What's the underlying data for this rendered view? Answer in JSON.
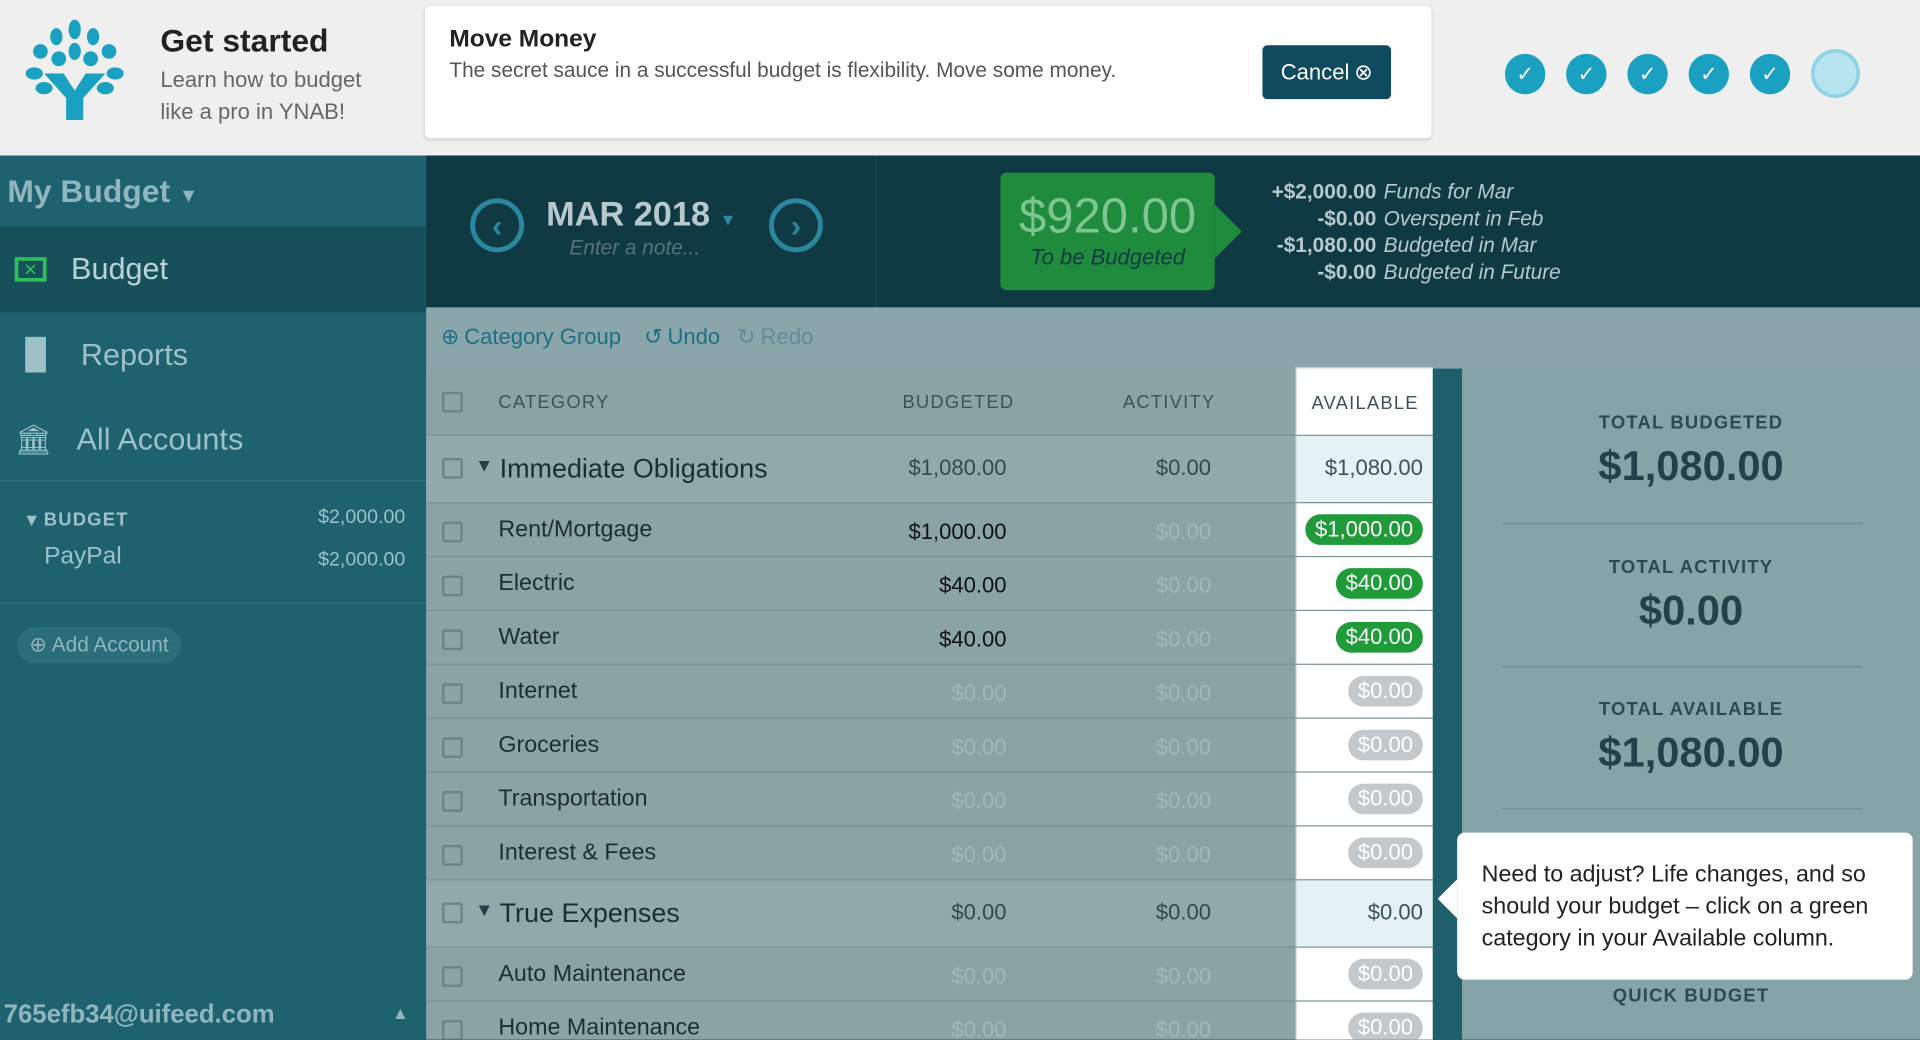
{
  "onboarding": {
    "title": "Get started",
    "subtitle": "Learn how to budget like a pro in YNAB!",
    "step_title": "Move Money",
    "step_text": "The secret sauce in a successful budget is flexibility. Move some money.",
    "cancel_label": "Cancel",
    "steps_completed": 5,
    "steps_total": 6
  },
  "sidebar": {
    "budget_name": "My Budget",
    "nav": [
      {
        "label": "Budget",
        "icon": "envelope-icon"
      },
      {
        "label": "Reports",
        "icon": "bar-chart-icon"
      },
      {
        "label": "All Accounts",
        "icon": "bank-icon"
      }
    ],
    "account_group": "BUDGET",
    "account_group_total": "$2,000.00",
    "accounts": [
      {
        "name": "PayPal",
        "balance": "$2,000.00"
      }
    ],
    "add_account": "Add Account",
    "email": "765efb34@uifeed.com"
  },
  "header": {
    "month": "MAR 2018",
    "note_placeholder": "Enter a note...",
    "to_be_budgeted": "$920.00",
    "to_be_budgeted_label": "To be Budgeted",
    "breakdown": [
      {
        "amount": "+$2,000.00",
        "label": "Funds for Mar"
      },
      {
        "amount": "-$0.00",
        "label": "Overspent in Feb"
      },
      {
        "amount": "-$1,080.00",
        "label": "Budgeted in Mar"
      },
      {
        "amount": "-$0.00",
        "label": "Budgeted in Future"
      }
    ]
  },
  "toolbar": {
    "category_group": "Category Group",
    "undo": "Undo",
    "redo": "Redo"
  },
  "table": {
    "columns": [
      "CATEGORY",
      "BUDGETED",
      "ACTIVITY",
      "AVAILABLE"
    ],
    "rows": [
      {
        "type": "group",
        "name": "Immediate Obligations",
        "budgeted": "$1,080.00",
        "activity": "$0.00",
        "available": "$1,080.00"
      },
      {
        "type": "cat",
        "name": "Rent/Mortgage",
        "budgeted": "$1,000.00",
        "activity": "$0.00",
        "available": "$1,000.00",
        "status": "green"
      },
      {
        "type": "cat",
        "name": "Electric",
        "budgeted": "$40.00",
        "activity": "$0.00",
        "available": "$40.00",
        "status": "green"
      },
      {
        "type": "cat",
        "name": "Water",
        "budgeted": "$40.00",
        "activity": "$0.00",
        "available": "$40.00",
        "status": "green"
      },
      {
        "type": "cat",
        "name": "Internet",
        "budgeted": "$0.00",
        "activity": "$0.00",
        "available": "$0.00",
        "status": "zero"
      },
      {
        "type": "cat",
        "name": "Groceries",
        "budgeted": "$0.00",
        "activity": "$0.00",
        "available": "$0.00",
        "status": "zero"
      },
      {
        "type": "cat",
        "name": "Transportation",
        "budgeted": "$0.00",
        "activity": "$0.00",
        "available": "$0.00",
        "status": "zero"
      },
      {
        "type": "cat",
        "name": "Interest & Fees",
        "budgeted": "$0.00",
        "activity": "$0.00",
        "available": "$0.00",
        "status": "zero"
      },
      {
        "type": "group",
        "name": "True Expenses",
        "budgeted": "$0.00",
        "activity": "$0.00",
        "available": "$0.00"
      },
      {
        "type": "cat",
        "name": "Auto Maintenance",
        "budgeted": "$0.00",
        "activity": "$0.00",
        "available": "$0.00",
        "status": "zero"
      },
      {
        "type": "cat",
        "name": "Home Maintenance",
        "budgeted": "$0.00",
        "activity": "$0.00",
        "available": "$0.00",
        "status": "zero"
      }
    ]
  },
  "summary": {
    "total_budgeted_label": "TOTAL BUDGETED",
    "total_budgeted": "$1,080.00",
    "total_activity_label": "TOTAL ACTIVITY",
    "total_activity": "$0.00",
    "total_available_label": "TOTAL AVAILABLE",
    "total_available": "$1,080.00",
    "quick_budget_label": "QUICK BUDGET"
  },
  "tooltip": {
    "text": "Need to adjust? Life changes, and so should your budget – click on a green category in your Available column."
  },
  "colors": {
    "green": "#1f9b3a",
    "zero_pill": "#c4c8ca",
    "header": "#0f3a44",
    "accent": "#1aa0c0"
  }
}
